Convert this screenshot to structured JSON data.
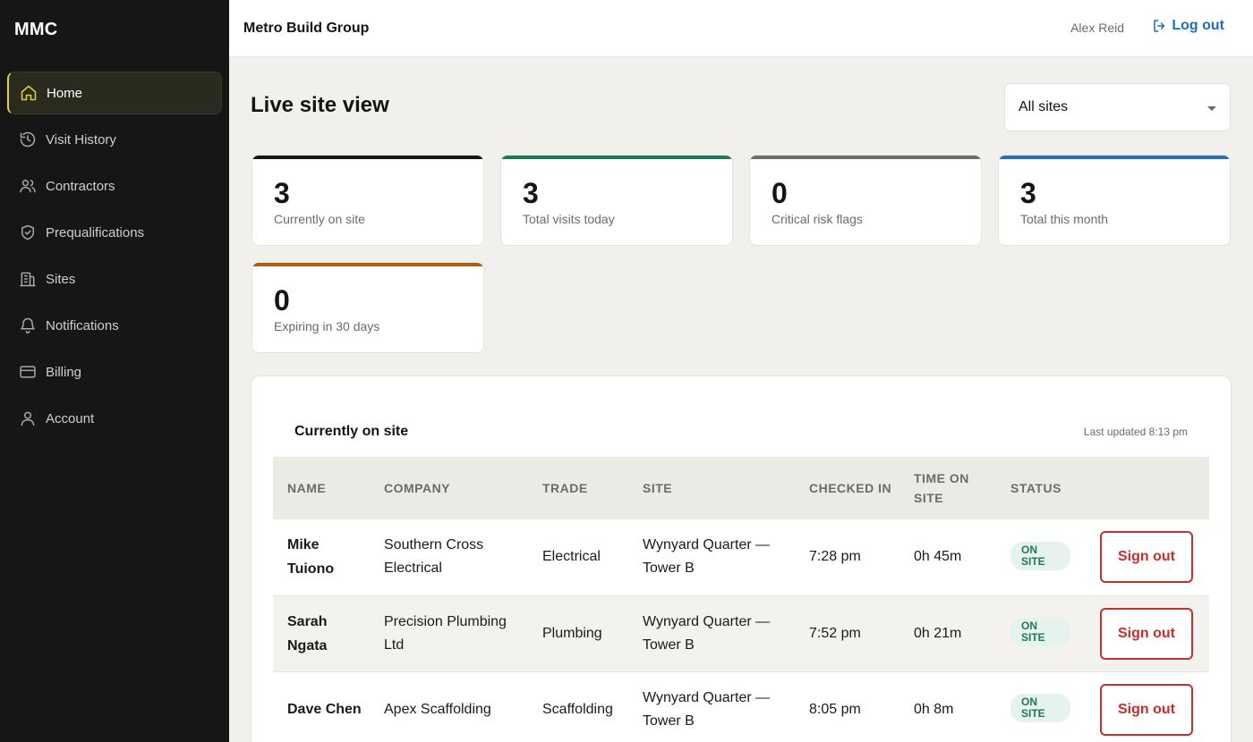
{
  "app": {
    "brand": "MMC"
  },
  "sidebar": {
    "items": [
      {
        "label": "Home",
        "icon": "home-icon",
        "active": true
      },
      {
        "label": "Visit History",
        "icon": "history-icon"
      },
      {
        "label": "Contractors",
        "icon": "users-icon"
      },
      {
        "label": "Prequalifications",
        "icon": "shield-check-icon"
      },
      {
        "label": "Sites",
        "icon": "building-icon"
      },
      {
        "label": "Notifications",
        "icon": "bell-icon"
      },
      {
        "label": "Billing",
        "icon": "credit-card-icon"
      },
      {
        "label": "Account",
        "icon": "user-icon"
      }
    ]
  },
  "topbar": {
    "org": "Metro Build Group",
    "user": "Alex Reid",
    "logout": "Log out"
  },
  "page": {
    "title": "Live site view",
    "site_filter": "All sites"
  },
  "stats": [
    {
      "value": "3",
      "label": "Currently on site",
      "color": "#141414"
    },
    {
      "value": "3",
      "label": "Total visits today",
      "color": "#1a7a5e"
    },
    {
      "value": "0",
      "label": "Critical risk flags",
      "color": "#6e6e6a"
    },
    {
      "value": "3",
      "label": "Total this month",
      "color": "#2a6db5"
    },
    {
      "value": "0",
      "label": "Expiring in 30 days",
      "color": "#a8610e"
    }
  ],
  "table": {
    "title": "Currently on site",
    "updated": "Last updated 8:13 pm",
    "headers": {
      "name": "NAME",
      "company": "COMPANY",
      "trade": "TRADE",
      "site": "SITE",
      "checked_in": "CHECKED IN",
      "time_on_site": "TIME ON SITE",
      "status": "STATUS"
    },
    "rows": [
      {
        "name": "Mike Tuiono",
        "company": "Southern Cross Electrical",
        "trade": "Electrical",
        "site": "Wynyard Quarter — Tower B",
        "checked_in": "7:28 pm",
        "time_on_site": "0h 45m",
        "status": "ON SITE",
        "action": "Sign out"
      },
      {
        "name": "Sarah Ngata",
        "company": "Precision Plumbing Ltd",
        "trade": "Plumbing",
        "site": "Wynyard Quarter — Tower B",
        "checked_in": "7:52 pm",
        "time_on_site": "0h 21m",
        "status": "ON SITE",
        "action": "Sign out"
      },
      {
        "name": "Dave Chen",
        "company": "Apex Scaffolding",
        "trade": "Scaffolding",
        "site": "Wynyard Quarter — Tower B",
        "checked_in": "8:05 pm",
        "time_on_site": "0h 8m",
        "status": "ON SITE",
        "action": "Sign out"
      }
    ]
  }
}
